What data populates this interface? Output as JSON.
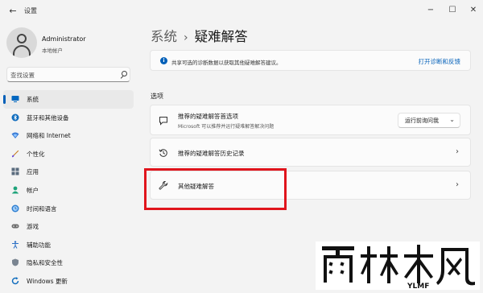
{
  "window": {
    "title": "设置",
    "back_icon": "back-arrow-icon",
    "controls": [
      "minimize-icon",
      "maximize-icon",
      "close-icon"
    ]
  },
  "profile": {
    "name": "Administrator",
    "account_type": "本地帐户"
  },
  "search": {
    "placeholder": "查找设置"
  },
  "sidebar": {
    "items": [
      {
        "label": "系统",
        "icon": "system-icon",
        "active": true
      },
      {
        "label": "蓝牙和其他设备",
        "icon": "bluetooth-icon"
      },
      {
        "label": "网络和 Internet",
        "icon": "network-icon"
      },
      {
        "label": "个性化",
        "icon": "personalization-icon"
      },
      {
        "label": "应用",
        "icon": "apps-icon"
      },
      {
        "label": "帐户",
        "icon": "accounts-icon"
      },
      {
        "label": "时间和语言",
        "icon": "time-language-icon"
      },
      {
        "label": "游戏",
        "icon": "gaming-icon"
      },
      {
        "label": "辅助功能",
        "icon": "accessibility-icon"
      },
      {
        "label": "隐私和安全性",
        "icon": "privacy-icon"
      },
      {
        "label": "Windows 更新",
        "icon": "windows-update-icon"
      }
    ]
  },
  "breadcrumb": {
    "parent": "系统",
    "separator": "›",
    "current": "疑难解答"
  },
  "info_banner": {
    "text": "共享可选的诊断数据以获取其他疑难解答建议。",
    "link": "打开诊断和反馈"
  },
  "options": {
    "section_title": "选项",
    "items": [
      {
        "title": "推荐的疑难解答首选项",
        "description": "Microsoft 可以推荐并运行疑难解答解决问题",
        "dropdown_value": "运行前询问我"
      },
      {
        "title": "推荐的疑难解答历史记录"
      },
      {
        "title": "其他疑难解答"
      }
    ]
  },
  "colors": {
    "accent": "#005fb8",
    "highlight": "#e0141c",
    "background": "#f3f3f3",
    "card": "#fbfbfb"
  },
  "watermark": {
    "logo_text": "雨林木风",
    "sub_text": "YLMF"
  }
}
